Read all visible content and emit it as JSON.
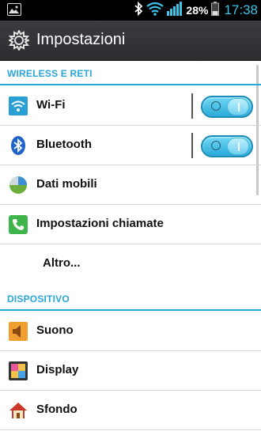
{
  "status_bar": {
    "battery_percent": "28%",
    "time": "17:38",
    "icons": [
      "gallery-icon",
      "bluetooth-icon",
      "wifi-icon",
      "signal-icon",
      "battery-icon"
    ]
  },
  "action_bar": {
    "title": "Impostazioni",
    "icon": "gear-icon"
  },
  "sections": [
    {
      "header": "WIRELESS E RETI",
      "items": [
        {
          "label": "Wi-Fi",
          "icon": "wifi-icon",
          "toggle": true,
          "toggle_on": true
        },
        {
          "label": "Bluetooth",
          "icon": "bluetooth-icon",
          "toggle": true,
          "toggle_on": true
        },
        {
          "label": "Dati mobili",
          "icon": "data-usage-icon"
        },
        {
          "label": "Impostazioni chiamate",
          "icon": "phone-icon"
        },
        {
          "label": "Altro..."
        }
      ]
    },
    {
      "header": "DISPOSITIVO",
      "items": [
        {
          "label": "Suono",
          "icon": "speaker-icon"
        },
        {
          "label": "Display",
          "icon": "display-icon"
        },
        {
          "label": "Sfondo",
          "icon": "home-icon"
        }
      ]
    }
  ],
  "colors": {
    "accent": "#2aa6d8",
    "status_time": "#3ec3e6",
    "action_bar": "#2f3034"
  }
}
